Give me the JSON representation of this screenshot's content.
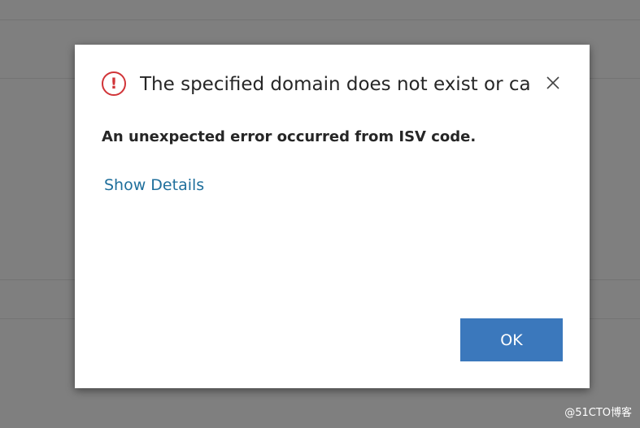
{
  "colors": {
    "overlay": "#7f7f7f",
    "dialog_background": "#ffffff",
    "error": "#d13438",
    "link": "#1f6f9c",
    "primary_button": "#3b78bc",
    "text": "#262626"
  },
  "dialog": {
    "icon": "error-exclamation-icon",
    "title": "The specified domain does not exist or can...",
    "close_icon": "close-icon",
    "message": "An unexpected error occurred from ISV code.",
    "details_link": "Show Details",
    "ok_label": "OK"
  },
  "watermark": {
    "text": "@51CTO博客"
  }
}
